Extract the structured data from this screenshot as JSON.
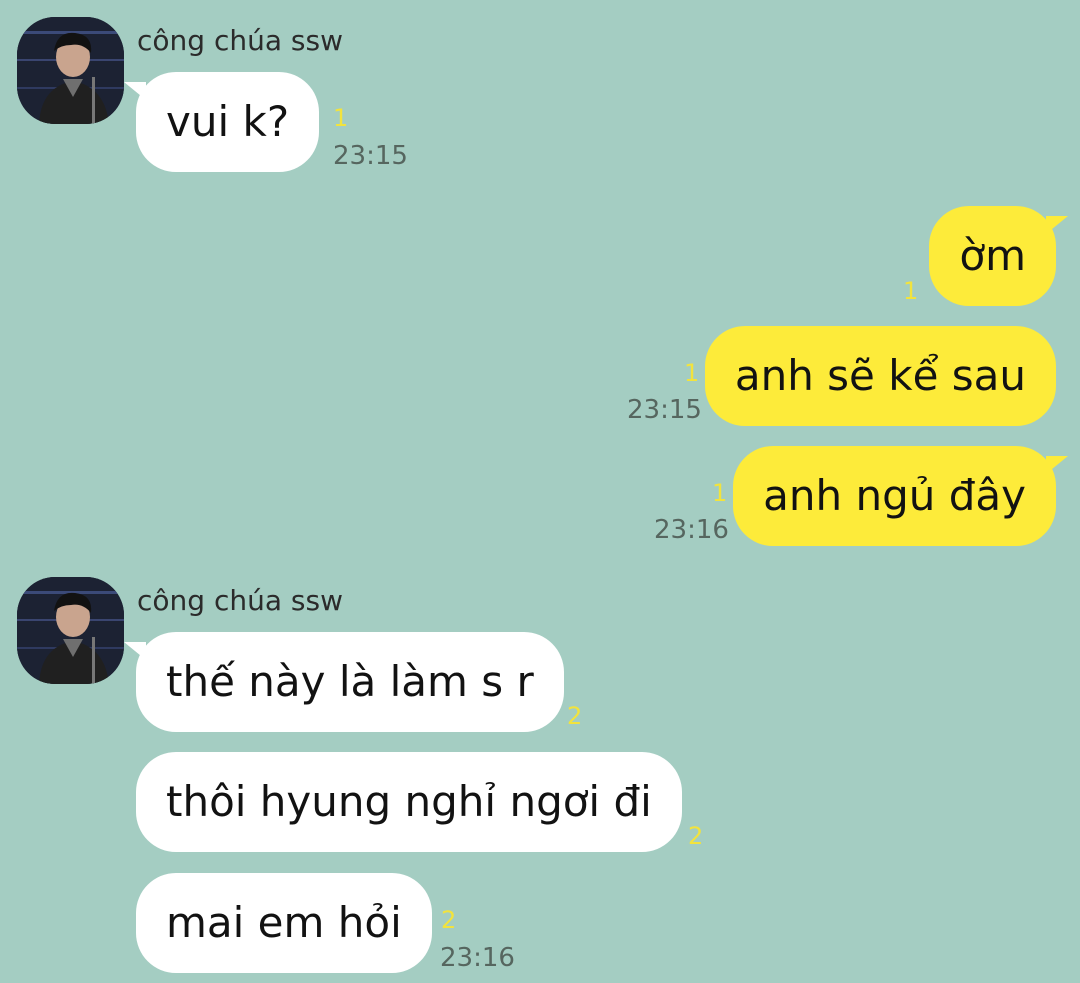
{
  "chat": {
    "group1": {
      "sender": "công chúa ssw",
      "messages": [
        {
          "text": "vui k?",
          "unread": "1",
          "time": "23:15"
        }
      ]
    },
    "group2": {
      "messages": [
        {
          "text": "ờm",
          "unread": "1"
        },
        {
          "text": "anh sẽ kể sau",
          "unread": "1",
          "time": "23:15"
        },
        {
          "text": "anh ngủ đây",
          "unread": "1",
          "time": "23:16"
        }
      ]
    },
    "group3": {
      "sender": "công chúa ssw",
      "messages": [
        {
          "text": "thế này là làm s r",
          "unread": "2"
        },
        {
          "text": "thôi hyung nghỉ ngơi đi",
          "unread": "2"
        },
        {
          "text": "mai em hỏi",
          "unread": "2",
          "time": "23:16"
        }
      ]
    }
  },
  "colors": {
    "background": "#a4cdc2",
    "incoming_bubble": "#ffffff",
    "outgoing_bubble": "#fdeb3a",
    "unread_count": "#f2e33d",
    "timestamp": "#56665f"
  }
}
